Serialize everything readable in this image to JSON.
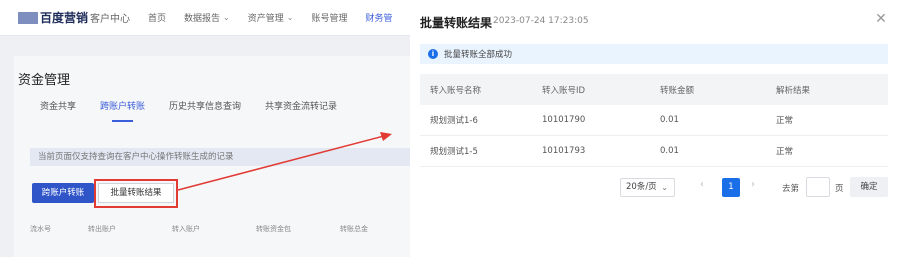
{
  "background": {
    "logo": "百度营销",
    "logo_sub": "客户中心",
    "nav": [
      {
        "label": "首页"
      },
      {
        "label": "数据报告"
      },
      {
        "label": "资产管理"
      },
      {
        "label": "账号管理"
      },
      {
        "label": "财务管"
      }
    ],
    "page_title": "资金管理",
    "tabs": [
      "资金共享",
      "跨账户转账",
      "历史共享信息查询",
      "共享资金流转记录"
    ],
    "notice": "当前页面仅支持查询在客户中心操作转账生成的记录",
    "btn_transfer": "跨账户转账",
    "btn_batch_result": "批量转账结果",
    "table_headers": [
      "流水号",
      "转出账户",
      "转入账户",
      "转账资金包",
      "转账总金"
    ]
  },
  "drawer": {
    "title": "批量转账结果",
    "timestamp": "2023-07-24 17:23:05",
    "alert": "批量转账全部成功",
    "columns": [
      "转入账号名称",
      "转入账号ID",
      "转账金额",
      "解析结果"
    ],
    "rows": [
      {
        "name": "规划测试1-6",
        "id": "10101790",
        "amount": "0.01",
        "result": "正常"
      },
      {
        "name": "规划测试1-5",
        "id": "10101793",
        "amount": "0.01",
        "result": "正常"
      }
    ],
    "pagination": {
      "page_size": "20条/页",
      "current_page": "1",
      "goto_label": "去第",
      "page_unit": "页",
      "confirm": "确定"
    }
  },
  "colors": {
    "accent": "#1a6fe8",
    "annotation": "#e13b33"
  }
}
